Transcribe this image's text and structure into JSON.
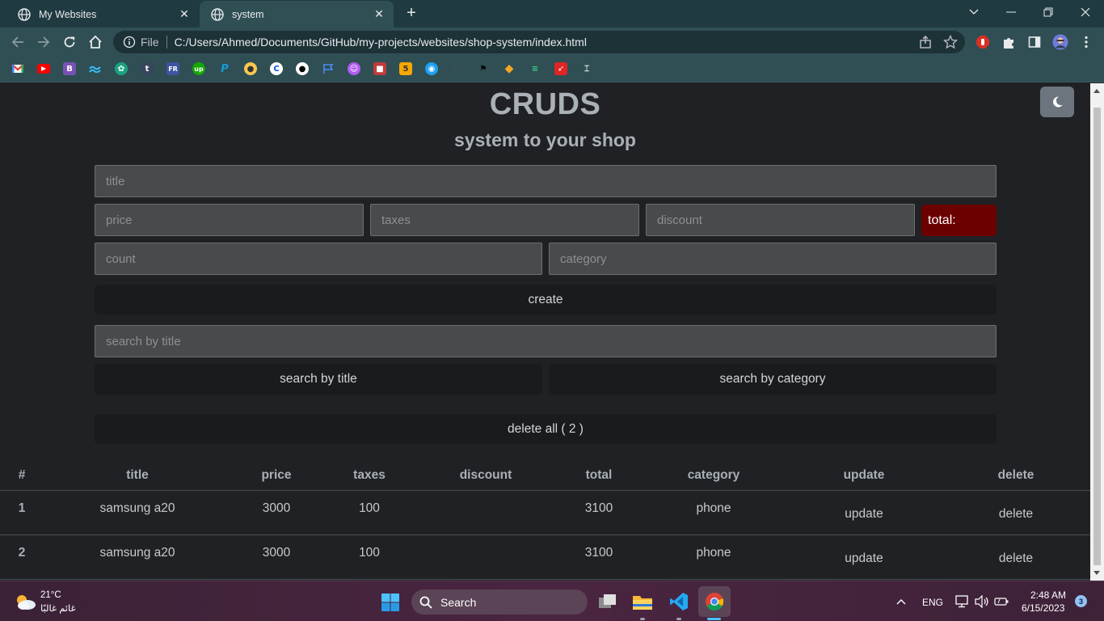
{
  "browser": {
    "tabs": [
      {
        "title": "My Websites",
        "active": false
      },
      {
        "title": "system",
        "active": true
      }
    ],
    "new_tab": "+",
    "close_glyph": "✕",
    "address": {
      "scheme": "File",
      "url": "C:/Users/Ahmed/Documents/GitHub/my-projects/websites/shop-system/index.html"
    },
    "bookmarks": [
      "gmail-icon",
      "youtube-icon",
      "bootstrap-icon",
      "tailwind-icon",
      "chatgpt-icon",
      "tumblr-icon",
      "frontend-mentor-icon",
      "upwork-icon",
      "paypal-icon",
      "extension-icon",
      "coursera-icon",
      "github-icon",
      "flag-icon",
      "chat-icon",
      "cube-icon",
      "html5-icon",
      "circle-icon",
      "blank-icon",
      "pennant-icon",
      "diamond-icon",
      "frame-icon",
      "arrow-icon",
      "glasses-icon"
    ]
  },
  "page": {
    "title": "CRUDS",
    "subtitle": "system to your shop",
    "inputs": {
      "title": "title",
      "price": "price",
      "taxes": "taxes",
      "discount": "discount",
      "count": "count",
      "category": "category",
      "search": "search by title"
    },
    "total_label": "total:",
    "buttons": {
      "create": "create",
      "search_title": "search by title",
      "search_category": "search by category",
      "delete_all": "delete all ( 2 )"
    },
    "table": {
      "headers": [
        "#",
        "title",
        "price",
        "taxes",
        "discount",
        "total",
        "category",
        "update",
        "delete"
      ],
      "rows": [
        {
          "id": "1",
          "title": "samsung a20",
          "price": "3000",
          "taxes": "100",
          "discount": "",
          "total": "3100",
          "category": "phone",
          "update": "update",
          "delete": "delete"
        },
        {
          "id": "2",
          "title": "samsung a20",
          "price": "3000",
          "taxes": "100",
          "discount": "",
          "total": "3100",
          "category": "phone",
          "update": "update",
          "delete": "delete"
        }
      ]
    },
    "colors": {
      "background": "#202124",
      "total_bg": "#6b0000",
      "button_bg": "#191b1e",
      "input_bg": "#484a4c"
    }
  },
  "taskbar": {
    "weather": {
      "temp": "21°C",
      "condition": "غائم غالبًا"
    },
    "search_label": "Search",
    "language": "ENG",
    "time": "2:48 AM",
    "date": "6/15/2023",
    "notification_count": "3"
  }
}
